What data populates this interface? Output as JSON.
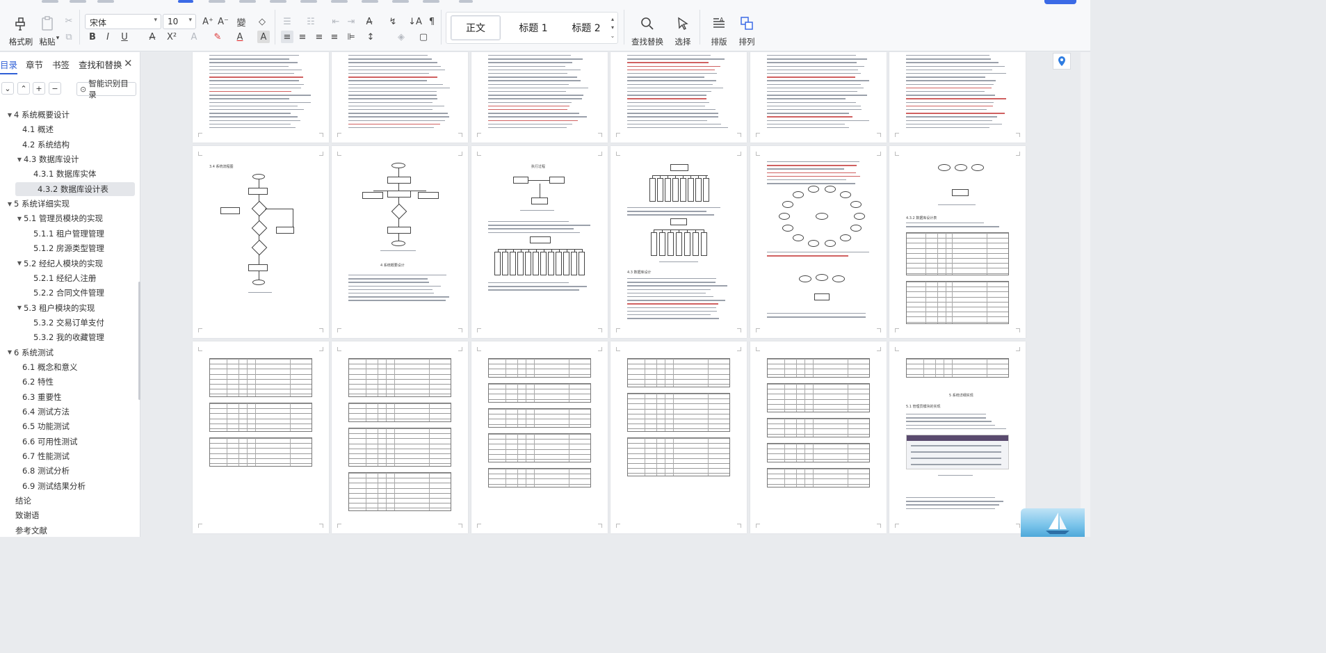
{
  "ribbon": {
    "format_painter": "格式刷",
    "paste": "粘贴",
    "font_name": "宋体",
    "font_size": "10",
    "styles": [
      "正文",
      "标题 1",
      "标题 2"
    ],
    "find_replace": "查找替换",
    "select": "选择",
    "typeset": "排版",
    "arrange": "排列"
  },
  "nav": {
    "tabs": [
      "目录",
      "章节",
      "书签",
      "查找和替换"
    ],
    "smart_toc": "智能识别目录",
    "toc": [
      {
        "label": "4 系统概要设计",
        "level": 0,
        "expanded": true
      },
      {
        "label": "4.1 概述",
        "level": 1
      },
      {
        "label": "4.2 系统结构",
        "level": 1
      },
      {
        "label": "4.3 数据库设计",
        "level": 1,
        "expanded": true
      },
      {
        "label": "4.3.1 数据库实体",
        "level": 2
      },
      {
        "label": "4.3.2 数据库设计表",
        "level": 2,
        "selected": true
      },
      {
        "label": "5 系统详细实现",
        "level": 0,
        "expanded": true
      },
      {
        "label": "5.1 管理员模块的实现",
        "level": 1,
        "expanded": true
      },
      {
        "label": "5.1.1 租户管理管理",
        "level": 2
      },
      {
        "label": "5.1.2 房源类型管理",
        "level": 2
      },
      {
        "label": "5.2 经纪人模块的实现",
        "level": 1,
        "expanded": true
      },
      {
        "label": "5.2.1 经纪人注册",
        "level": 2
      },
      {
        "label": "5.2.2 合同文件管理",
        "level": 2
      },
      {
        "label": "5.3 租户模块的实现",
        "level": 1,
        "expanded": true
      },
      {
        "label": "5.3.2 交易订单支付",
        "level": 2
      },
      {
        "label": "5.3.2 我的收藏管理",
        "level": 2
      },
      {
        "label": "6 系统测试",
        "level": 0,
        "expanded": true
      },
      {
        "label": "6.1 概念和意义",
        "level": 1
      },
      {
        "label": "6.2 特性",
        "level": 1
      },
      {
        "label": "6.3 重要性",
        "level": 1
      },
      {
        "label": "6.4 测试方法",
        "level": 1
      },
      {
        "label": "6.5 功能测试",
        "level": 1
      },
      {
        "label": "6.6 可用性测试",
        "level": 1
      },
      {
        "label": "6.7 性能测试",
        "level": 1
      },
      {
        "label": "6.8 测试分析",
        "level": 1
      },
      {
        "label": "6.9 测试结果分析",
        "level": 1
      },
      {
        "label": "结论",
        "level": 0
      },
      {
        "label": "致谢语",
        "level": 0
      },
      {
        "label": "参考文献",
        "level": 0
      }
    ]
  },
  "pages": {
    "row2": {
      "p1_heading": "3.4 系统流程图",
      "p2_heading": "4 系统概要设计",
      "p3_heading": "执行过程",
      "p4_heading": "4.3 数据库设计",
      "p6_heading": "4.3.2 数据库设计表"
    },
    "row3": {
      "p6_heading": "5 系统详细实现",
      "p6_sub": "5.1 管理员模块的实现"
    }
  }
}
